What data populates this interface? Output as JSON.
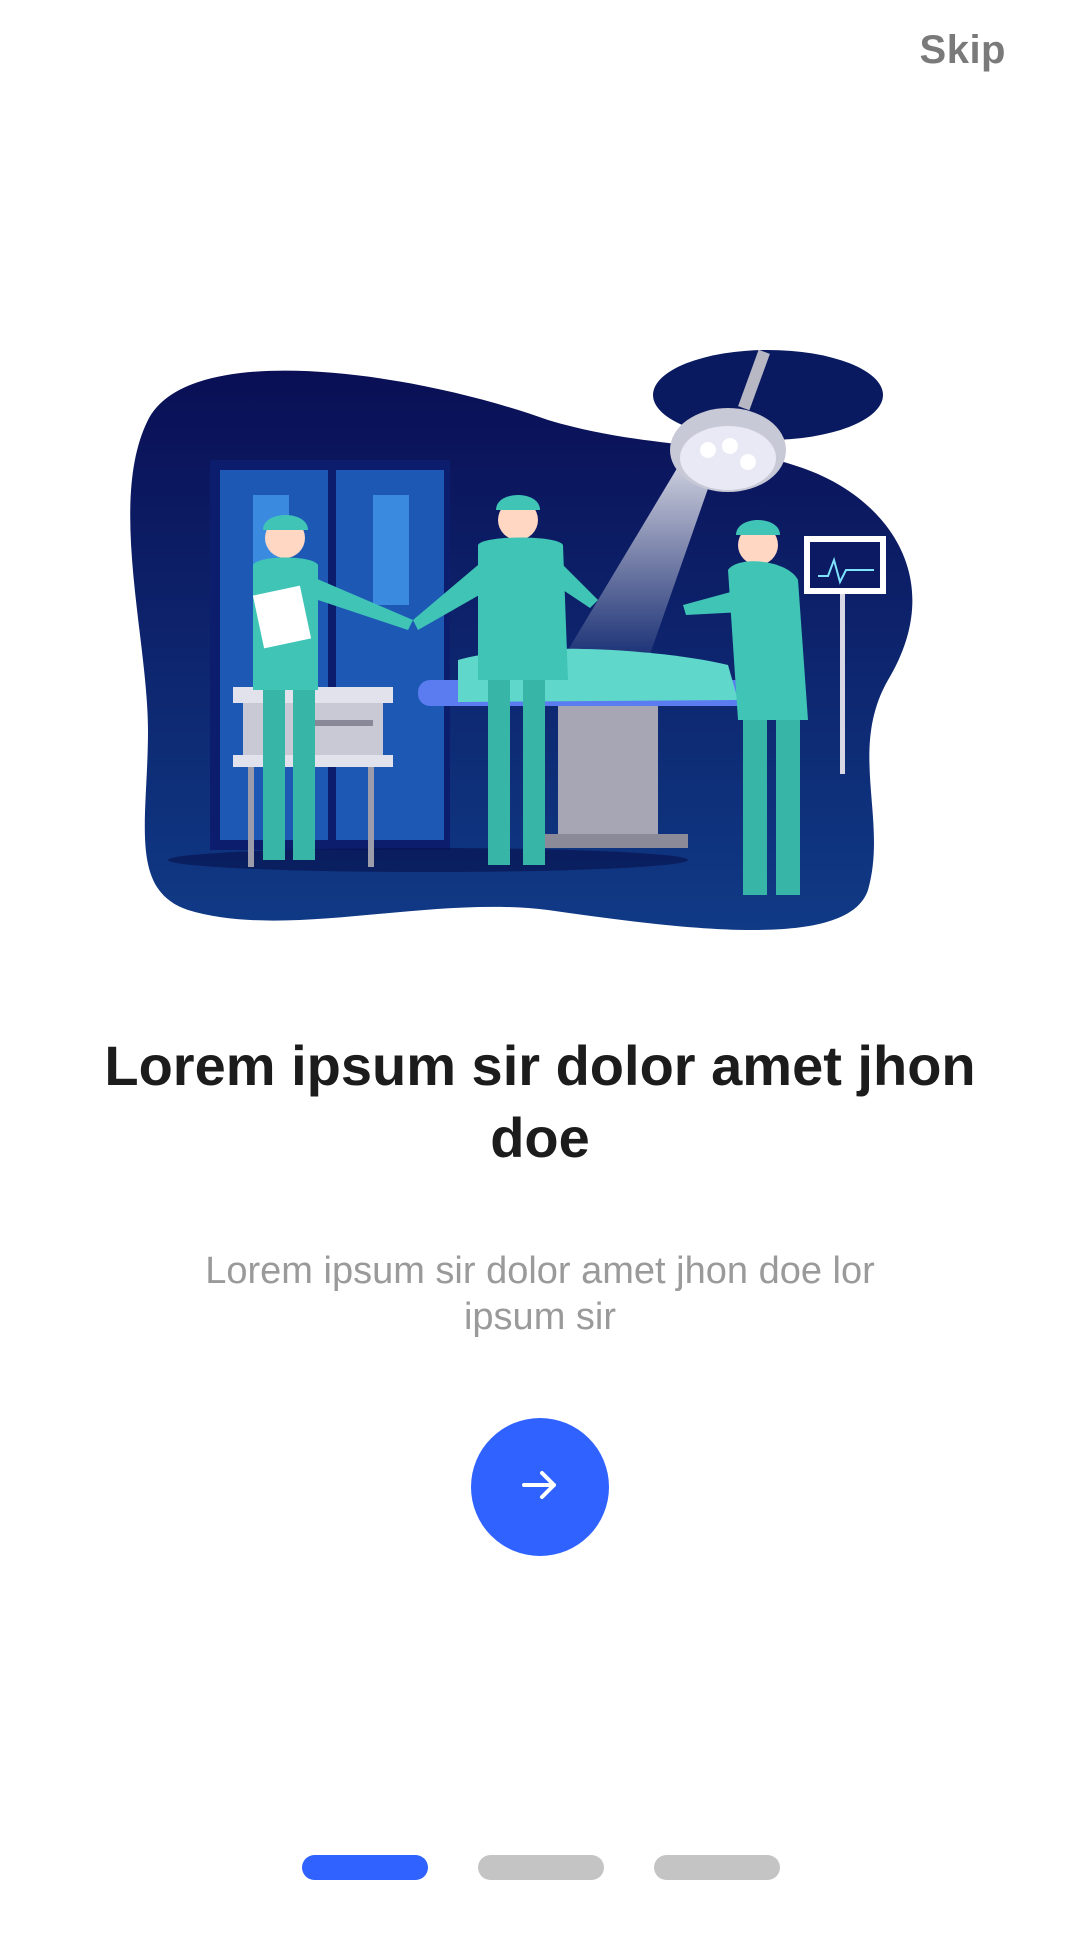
{
  "header": {
    "skip_label": "Skip"
  },
  "illustration": {
    "subject": "surgery-scene-illustration",
    "colors": {
      "background_blob": "#0b1a63",
      "scrubs": "#3fc4b6",
      "door": "#1f56b8",
      "table": "#9a9aa6"
    }
  },
  "content": {
    "title": "Lorem ipsum sir  dolor amet jhon doe",
    "subtitle": "Lorem ipsum sir dolor  amet jhon doe lor ipsum sir"
  },
  "next_button": {
    "icon": "arrow-right-icon",
    "color": "#2f62ff"
  },
  "pagination": {
    "total": 3,
    "active_index": 0,
    "active_color": "#2f62ff",
    "inactive_color": "#c4c4c4"
  }
}
